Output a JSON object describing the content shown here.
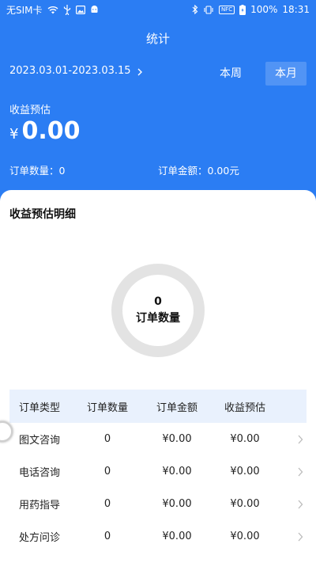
{
  "status_bar": {
    "carrier": "无SIM卡",
    "nfc": "NFC",
    "battery": "100%",
    "time": "18:31"
  },
  "header": {
    "title": "统计",
    "date_range": "2023.03.01-2023.03.15",
    "toggle_week": "本周",
    "toggle_month": "本月",
    "selected_toggle": "本月"
  },
  "income": {
    "label": "收益预估",
    "currency": "¥",
    "value": "0.00"
  },
  "summary": {
    "order_count": "订单数量：0",
    "order_amount": "订单金额：0.00元"
  },
  "detail": {
    "title": "收益预估明细",
    "ring_count": "0",
    "ring_label": "订单数量"
  },
  "table": {
    "headers": [
      "订单类型",
      "订单数量",
      "订单金额",
      "收益预估"
    ],
    "rows": [
      {
        "type": "图文咨询",
        "count": "0",
        "amount": "¥0.00",
        "income": "¥0.00"
      },
      {
        "type": "电话咨询",
        "count": "0",
        "amount": "¥0.00",
        "income": "¥0.00"
      },
      {
        "type": "用药指导",
        "count": "0",
        "amount": "¥0.00",
        "income": "¥0.00"
      },
      {
        "type": "处方问诊",
        "count": "0",
        "amount": "¥0.00",
        "income": "¥0.00"
      }
    ]
  },
  "colors": {
    "primary": "#2b7df3",
    "table_header_bg": "#e9f1fd",
    "ring": "#e3e3e3"
  }
}
